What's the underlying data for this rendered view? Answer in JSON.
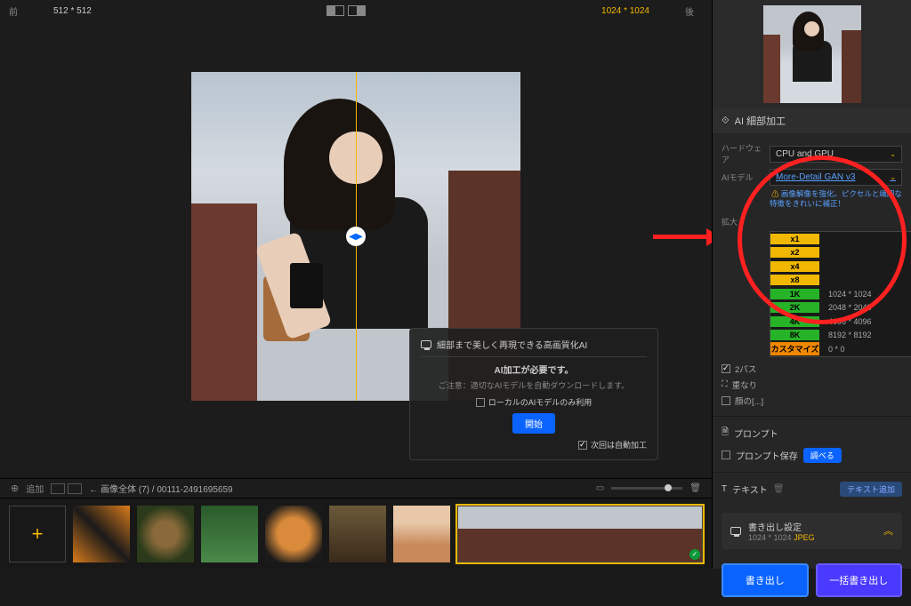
{
  "topbar": {
    "before_label": "前",
    "dim_before": "512 * 512",
    "dim_after": "1024 * 1024",
    "after_label": "後"
  },
  "overlay": {
    "header": "細部まで美しく再現できる高画質化AI",
    "need": "AI加工が必要です。",
    "note": "ご注意：適切なAIモデルを自動ダウンロードします。",
    "local_only": "ローカルのAIモデルのみ利用",
    "start": "開始",
    "auto_next": "次回は自動加工"
  },
  "strip": {
    "add_label": "追加",
    "path": "← 画像全体 (7)  / 00111-2491695659"
  },
  "sidebar": {
    "section_title": "AI 細部加工",
    "hardware_label": "ハードウェア",
    "hardware_value": "CPU and GPU",
    "model_label": "AIモデル",
    "model_value": "More-Detail GAN v3",
    "model_desc": "画像解像を強化。ピクセルと繊細な特徴をきれいに補正！",
    "scale_label": "拡大",
    "scale_items": [
      {
        "name": "x1",
        "dims": "",
        "cls": "c-yellow"
      },
      {
        "name": "x2",
        "dims": "",
        "cls": "c-yellow"
      },
      {
        "name": "x4",
        "dims": "",
        "cls": "c-yellow"
      },
      {
        "name": "x8",
        "dims": "",
        "cls": "c-yellow"
      },
      {
        "name": "1K",
        "dims": "1024 * 1024",
        "cls": "c-green"
      },
      {
        "name": "2K",
        "dims": "2048 * 2048",
        "cls": "c-green"
      },
      {
        "name": "4K",
        "dims": "4096 * 4096",
        "cls": "c-green"
      },
      {
        "name": "8K",
        "dims": "8192 * 8192",
        "cls": "c-green"
      },
      {
        "name": "カスタマイズ",
        "dims": "0 * 0",
        "cls": "c-orange"
      }
    ],
    "two_pass": "2パス",
    "overlay_label": "重なり",
    "face_label": "顔の[...]",
    "prompt_title": "プロンプト",
    "prompt_save": "プロンプト保存",
    "sort_btn": "調べる",
    "text_title": "テキスト",
    "text_add": "テキスト追加",
    "export_title": "書き出し設定",
    "export_dims": "1024 * 1024",
    "export_fmt": "JPEG",
    "export_btn": "書き出し",
    "batch_btn": "一括書き出し"
  }
}
